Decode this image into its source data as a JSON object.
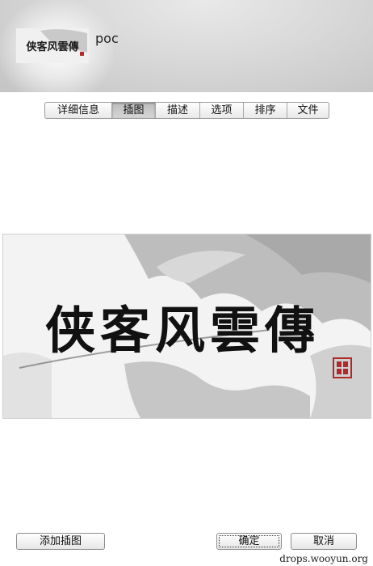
{
  "header": {
    "title": "poc",
    "thumbnail_icon": "book-cover-thumbnail"
  },
  "tabs": [
    {
      "label": "详细信息",
      "selected": false
    },
    {
      "label": "插图",
      "selected": true
    },
    {
      "label": "描述",
      "selected": false
    },
    {
      "label": "选项",
      "selected": false
    },
    {
      "label": "排序",
      "selected": false
    },
    {
      "label": "文件",
      "selected": false
    }
  ],
  "artwork": {
    "calligraphy": "侠客风雲傳",
    "seal_icon": "red-seal-stamp"
  },
  "buttons": {
    "add_artwork": "添加插图",
    "ok": "确定",
    "cancel": "取消"
  },
  "watermark": "drops.wooyun.org"
}
